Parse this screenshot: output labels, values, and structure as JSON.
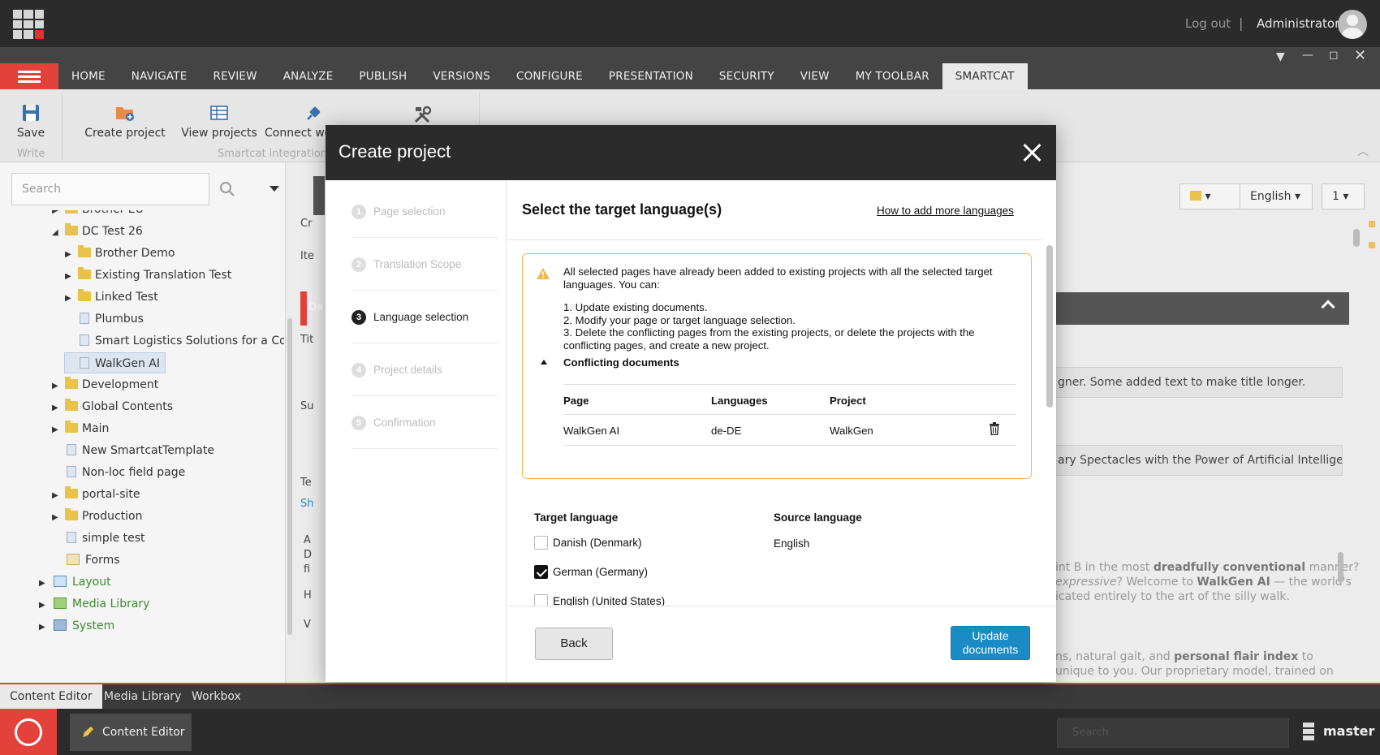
{
  "topbar": {
    "logout": "Log out",
    "separator": "|",
    "user": "Administrator"
  },
  "ribbon": {
    "tabs": [
      "HOME",
      "NAVIGATE",
      "REVIEW",
      "ANALYZE",
      "PUBLISH",
      "VERSIONS",
      "CONFIGURE",
      "PRESENTATION",
      "SECURITY",
      "VIEW",
      "MY TOOLBAR",
      "SMARTCAT"
    ],
    "active_tab": "SMARTCAT",
    "save": "Save",
    "write_group": "Write",
    "create_project": "Create project",
    "view_projects": "View projects",
    "connect": "Connect wo",
    "group_label": "Smartcat integration"
  },
  "left": {
    "search_placeholder": "Search",
    "tree": [
      {
        "label": "Brother EU",
        "type": "folder",
        "level": 2,
        "arrow": "right"
      },
      {
        "label": "DC Test 26",
        "type": "folder",
        "level": 2,
        "arrow": "down"
      },
      {
        "label": "Brother Demo",
        "type": "folder",
        "level": 3,
        "arrow": "right"
      },
      {
        "label": "Existing Translation Test",
        "type": "folder",
        "level": 3,
        "arrow": "right"
      },
      {
        "label": "Linked Test",
        "type": "folder",
        "level": 3,
        "arrow": "right"
      },
      {
        "label": "Plumbus",
        "type": "doc",
        "level": 3,
        "arrow": ""
      },
      {
        "label": "Smart Logistics Solutions for a Con",
        "type": "doc",
        "level": 3,
        "arrow": ""
      },
      {
        "label": "WalkGen AI",
        "type": "doc",
        "level": 3,
        "arrow": "",
        "selected": true
      },
      {
        "label": "Development",
        "type": "folder",
        "level": 2,
        "arrow": "right"
      },
      {
        "label": "Global Contents",
        "type": "folder",
        "level": 2,
        "arrow": "right"
      },
      {
        "label": "Main",
        "type": "folder",
        "level": 2,
        "arrow": "right"
      },
      {
        "label": "New SmartcatTemplate",
        "type": "doc",
        "level": 2,
        "arrow": ""
      },
      {
        "label": "Non-loc field page",
        "type": "doc",
        "level": 2,
        "arrow": ""
      },
      {
        "label": "portal-site",
        "type": "folder",
        "level": 2,
        "arrow": "right"
      },
      {
        "label": "Production",
        "type": "folder",
        "level": 2,
        "arrow": "right"
      },
      {
        "label": "simple test",
        "type": "doc",
        "level": 2,
        "arrow": ""
      },
      {
        "label": "Forms",
        "type": "form",
        "level": 2,
        "arrow": ""
      },
      {
        "label": "Layout",
        "type": "layout",
        "level": 1,
        "arrow": "right",
        "green": true
      },
      {
        "label": "Media Library",
        "type": "media",
        "level": 1,
        "arrow": "right",
        "green": true
      },
      {
        "label": "System",
        "type": "system",
        "level": 1,
        "arrow": "right",
        "green": true
      }
    ]
  },
  "right": {
    "language": "English",
    "version": "1",
    "field_title": "gner. Some added text to make title longer.",
    "field_subtitle": "ary Spectacles with the Power of Artificial Intelligence",
    "para1_pre": "int B in the most ",
    "para1_bold": "dreadfully conventional",
    "para1_post": " manner?",
    "para2_pre": "expressive",
    "para2_mid": "? Welcome to ",
    "para2_bold": "WalkGen AI",
    "para2_post": " — the world's",
    "para3": "icated entirely to the art of the silly walk.",
    "para4_pre": "ns, natural gait, and ",
    "para4_bold": "personal flair index",
    "para4_post": " to",
    "para5": "unique to you. Our proprietary model, trained on",
    "edge_labels": [
      "Cr",
      "Ite",
      "Da",
      "Tit",
      "Su",
      "Te",
      "Sh",
      "A",
      "D",
      "fi",
      "H",
      "V"
    ]
  },
  "bottom": {
    "tabs": [
      "Content Editor",
      "Media Library",
      "Workbox"
    ],
    "task_app": "Content Editor",
    "search_placeholder": "Search",
    "database": "master"
  },
  "modal": {
    "title": "Create project",
    "steps": [
      {
        "num": "1",
        "label": "Page selection",
        "active": false
      },
      {
        "num": "2",
        "label": "Translation Scope",
        "active": false
      },
      {
        "num": "3",
        "label": "Language selection",
        "active": true
      },
      {
        "num": "4",
        "label": "Project details",
        "active": false
      },
      {
        "num": "5",
        "label": "Confirmation",
        "active": false
      }
    ],
    "heading": "Select the target language(s)",
    "help_link": "How to add more languages",
    "warning": {
      "intro": "All selected pages have already been added to existing projects with all the selected target languages. You can:",
      "options": [
        "1. Update existing documents.",
        "2. Modify your page or target language selection.",
        "3. Delete the conflicting pages from the existing projects, or delete the projects with the conflicting pages, and create a new project."
      ],
      "conflict_title": "Conflicting documents",
      "columns": [
        "Page",
        "Languages",
        "Project"
      ],
      "rows": [
        {
          "page": "WalkGen AI",
          "languages": "de-DE",
          "project": "WalkGen"
        }
      ]
    },
    "target_label": "Target language",
    "source_label": "Source language",
    "source_value": "English",
    "languages": [
      {
        "label": "Danish (Denmark)",
        "checked": false
      },
      {
        "label": "German (Germany)",
        "checked": true
      },
      {
        "label": "English (United States)",
        "checked": false
      }
    ],
    "back": "Back",
    "update": "Update documents"
  }
}
